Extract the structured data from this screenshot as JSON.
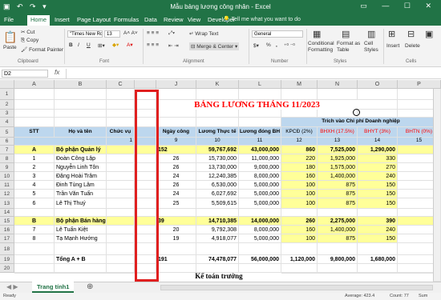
{
  "window": {
    "title": "Mẫu bảng lương công nhân - Excel"
  },
  "tabs": [
    "File",
    "Home",
    "Insert",
    "Page Layout",
    "Formulas",
    "Data",
    "Review",
    "View",
    "Developer"
  ],
  "tell_me": "Tell me what you want to do",
  "ribbon": {
    "paste": "Paste",
    "cut": "Cut",
    "copy": "Copy",
    "format_painter": "Format Painter",
    "clipboard": "Clipboard",
    "font_name": "\"Times New Ro",
    "font_size": "13",
    "font_group": "Font",
    "wrap_text": "Wrap Text",
    "merge_center": "Merge & Center",
    "alignment": "Alignment",
    "number_format": "General",
    "number": "Number",
    "conditional_formatting": "Conditional Formatting",
    "format_as_table": "Format as Table",
    "cell_styles": "Cell Styles",
    "styles": "Styles",
    "insert": "Insert",
    "delete": "Delete",
    "cells": "Cells",
    "bold": "B",
    "italic": "I",
    "underline": "U",
    "percent": "%",
    "comma": ","
  },
  "formula_bar": {
    "name_box": "D2",
    "fx": "fx"
  },
  "columns": [
    "A",
    "B",
    "C",
    "",
    "J",
    "K",
    "L",
    "M",
    "N",
    "O",
    "P"
  ],
  "rows": [
    "1",
    "2",
    "3",
    "4",
    "5",
    "6",
    "7",
    "8",
    "9",
    "10",
    "11",
    "12",
    "13",
    "14",
    "15",
    "16",
    "17",
    "18",
    "19",
    "20"
  ],
  "sheet": {
    "title": "BẢNG LƯƠNG THÁNG 11/2023",
    "trich_vao": "Trích vào Chi phí Doanh nghiệp",
    "headers": {
      "stt": "STT",
      "ho_ten": "Họ và tên",
      "chuc_vu": "Chức vụ",
      "ngay_cong": "Ngày công",
      "luong": "Lương Thực tế",
      "luong_dong_bh": "Lương đóng BH",
      "kpcd": "KPCĐ (2%)",
      "bhxh": "BHXH (17.5%)",
      "bhyt": "BHYT (3%)",
      "bhtn": "BHTN (0%)"
    },
    "index_row": [
      "1",
      "9",
      "10",
      "11",
      "12",
      "13",
      "14",
      "15"
    ],
    "sections": [
      {
        "stt": "A",
        "name": "Bộ phận Quản lý",
        "ngay": "152",
        "luong": "59,767,692",
        "bh": "43,000,000",
        "kpcd": "860",
        "bhxh": "7,525,000",
        "bhyt": "1,290,000",
        "bhtn": "0"
      },
      {
        "stt": "B",
        "name": "Bộ phận Bán hàng",
        "ngay": "39",
        "luong": "14,710,385",
        "bh": "14,000,000",
        "kpcd": "260",
        "bhxh": "2,275,000",
        "bhyt": "390",
        "bhtn": "0"
      }
    ],
    "employees": [
      {
        "stt": "1",
        "name": "Đoàn Công Lập",
        "ngay": "26",
        "luong": "15,730,000",
        "bh": "11,000,000",
        "kpcd": "220",
        "bhxh": "1,925,000",
        "bhyt": "330",
        "bhtn": "0"
      },
      {
        "stt": "2",
        "name": "Nguyễn Linh Tôn",
        "ngay": "26",
        "luong": "13,730,000",
        "bh": "9,000,000",
        "kpcd": "180",
        "bhxh": "1,575,000",
        "bhyt": "270",
        "bhtn": "0"
      },
      {
        "stt": "3",
        "name": "Đặng Hoài Trâm",
        "ngay": "24",
        "luong": "12,240,385",
        "bh": "8,000,000",
        "kpcd": "160",
        "bhxh": "1,400,000",
        "bhyt": "240",
        "bhtn": "0"
      },
      {
        "stt": "4",
        "name": "Đinh Tùng Lâm",
        "ngay": "26",
        "luong": "6,530,000",
        "bh": "5,000,000",
        "kpcd": "100",
        "bhxh": "875",
        "bhyt": "150",
        "bhtn": "0"
      },
      {
        "stt": "5",
        "name": "Trần Văn Tuấn",
        "ngay": "24",
        "luong": "6,027,692",
        "bh": "5,000,000",
        "kpcd": "100",
        "bhxh": "875",
        "bhyt": "150",
        "bhtn": "0"
      },
      {
        "stt": "6",
        "name": "Lê Thị Thuý",
        "ngay": "25",
        "luong": "5,509,615",
        "bh": "5,000,000",
        "kpcd": "100",
        "bhxh": "875",
        "bhyt": "150",
        "bhtn": "0"
      },
      {
        "stt": "7",
        "name": "Lê Tuấn Kiệt",
        "ngay": "20",
        "luong": "9,792,308",
        "bh": "8,000,000",
        "kpcd": "160",
        "bhxh": "1,400,000",
        "bhyt": "240",
        "bhtn": "0"
      },
      {
        "stt": "8",
        "name": "Tạ Mạnh Hướng",
        "ngay": "19",
        "luong": "4,918,077",
        "bh": "5,000,000",
        "kpcd": "100",
        "bhxh": "875",
        "bhyt": "150",
        "bhtn": "0"
      }
    ],
    "total": {
      "name": "Tổng A + B",
      "ngay": "191",
      "luong": "74,478,077",
      "bh": "56,000,000",
      "kpcd": "1,120,000",
      "bhxh": "9,800,000",
      "bhyt": "1,680,000",
      "bhtn": "0"
    },
    "ke_toan": "Kế toán trưởng"
  },
  "sheet_tab": "Trang tính1",
  "status": {
    "ready": "Ready",
    "average": "Average: 423.4",
    "count": "Count: 77",
    "sum": "Sum"
  },
  "colors": {
    "excel_green": "#217346",
    "blue_header": "#bdd7ee",
    "yellow": "#ffff99",
    "red": "#ff0000",
    "selection_box": "#e01f1f"
  }
}
